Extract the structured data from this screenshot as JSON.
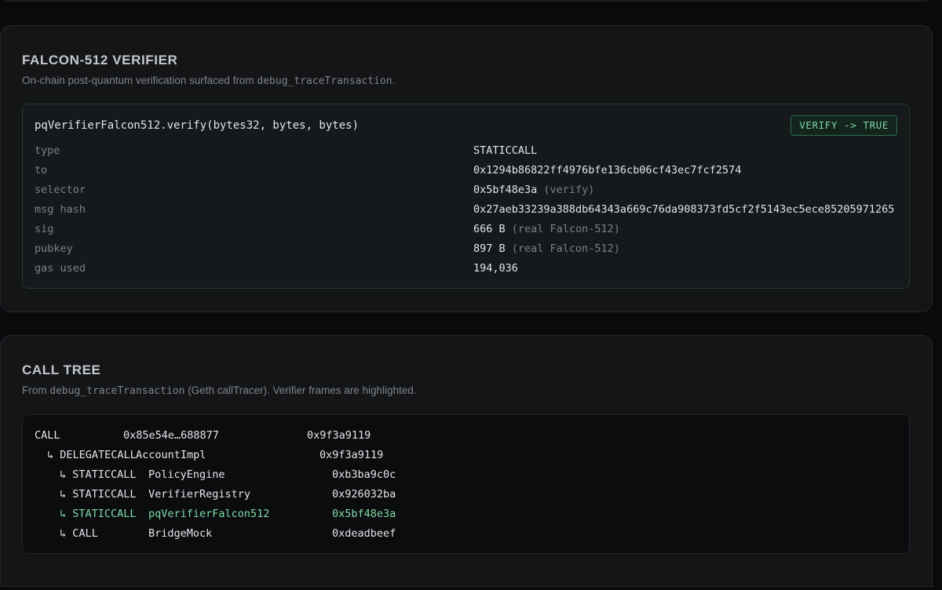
{
  "verifier": {
    "title": "FALCON-512 VERIFIER",
    "subtitle_prefix": "On-chain post-quantum verification surfaced from ",
    "subtitle_code": "debug_traceTransaction",
    "subtitle_suffix": ".",
    "signature": "pqVerifierFalcon512.verify(bytes32, bytes, bytes)",
    "badge": "VERIFY -> TRUE",
    "rows": [
      {
        "key": "type",
        "value": "STATICCALL",
        "note": ""
      },
      {
        "key": "to",
        "value": "0x1294b86822ff4976bfe136cb06cf43ec7fcf2574",
        "note": ""
      },
      {
        "key": "selector",
        "value": "0x5bf48e3a",
        "note": " (verify)"
      },
      {
        "key": "msg hash",
        "value": "0x27aeb33239a388db64343a669c76da908373fd5cf2f5143ec5ece85205971265",
        "note": ""
      },
      {
        "key": "sig",
        "value": "666 B",
        "note": " (real Falcon-512)"
      },
      {
        "key": "pubkey",
        "value": "897 B",
        "note": " (real Falcon-512)"
      },
      {
        "key": "gas used",
        "value": "194,036",
        "note": ""
      }
    ]
  },
  "calltree": {
    "title": "CALL TREE",
    "subtitle_prefix": "From ",
    "subtitle_code": "debug_traceTransaction",
    "subtitle_suffix": " (Geth callTracer). Verifier frames are highlighted.",
    "rows": [
      {
        "type": "CALL",
        "target": "0x85e54e…688877",
        "selector": "0x9f3a9119",
        "highlight": false
      },
      {
        "type": "↳ DELEGATECALL",
        "target": "AccountImpl",
        "selector": "0x9f3a9119",
        "highlight": false
      },
      {
        "type": "↳ STATICCALL",
        "target": "PolicyEngine",
        "selector": "0xb3ba9c0c",
        "highlight": false
      },
      {
        "type": "↳ STATICCALL",
        "target": "VerifierRegistry",
        "selector": "0x926032ba",
        "highlight": false
      },
      {
        "type": "↳ STATICCALL",
        "target": "pqVerifierFalcon512",
        "selector": "0x5bf48e3a",
        "highlight": true
      },
      {
        "type": "↳ CALL",
        "target": "BridgeMock",
        "selector": "0xdeadbeef",
        "highlight": false
      }
    ]
  },
  "colors": {
    "accent_green": "#7fd9a6",
    "background": "#090a0c",
    "card": "#131517"
  }
}
